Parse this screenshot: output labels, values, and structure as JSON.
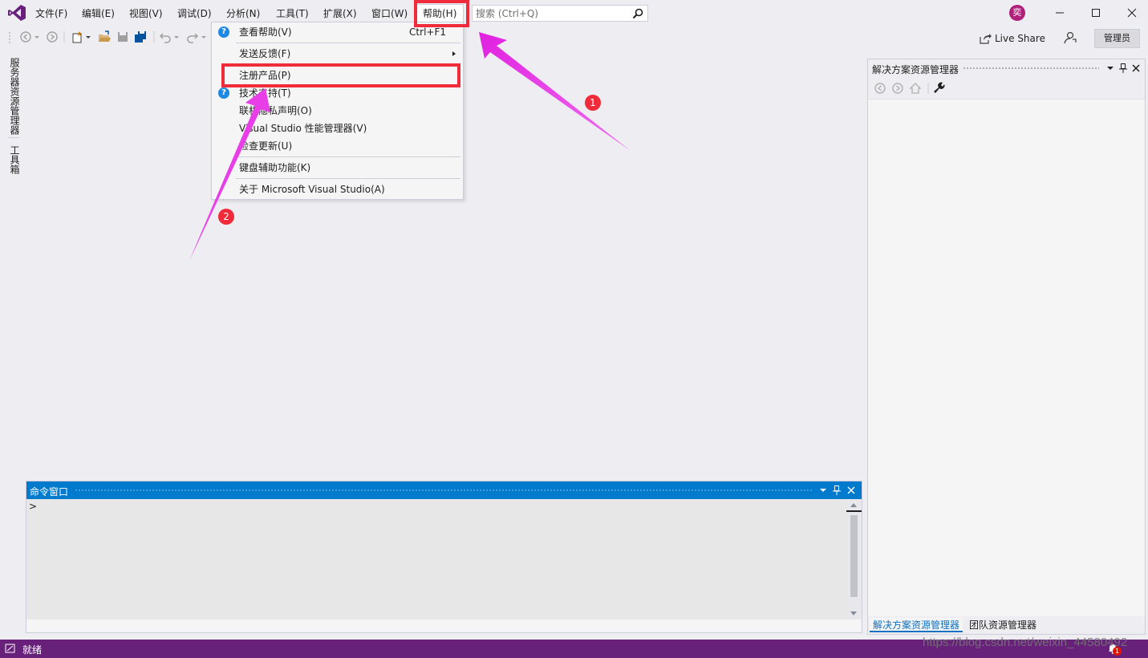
{
  "menubar": {
    "items": [
      {
        "label": "文件(F)"
      },
      {
        "label": "编辑(E)"
      },
      {
        "label": "视图(V)"
      },
      {
        "label": "调试(D)"
      },
      {
        "label": "分析(N)"
      },
      {
        "label": "工具(T)"
      },
      {
        "label": "扩展(X)"
      },
      {
        "label": "窗口(W)"
      },
      {
        "label": "帮助(H)"
      }
    ],
    "search_placeholder": "搜索 (Ctrl+Q)",
    "user_avatar": "奕"
  },
  "toolbar": {
    "live_share_label": "Live Share",
    "admin_label": "管理员"
  },
  "left_tabs": {
    "server_explorer": "服务器资源管理器",
    "toolbox": "工具箱"
  },
  "help_menu": {
    "items": [
      {
        "label": "查看帮助(V)",
        "shortcut": "Ctrl+F1"
      },
      {
        "label": "发送反馈(F)"
      },
      {
        "label": "注册产品(P)"
      },
      {
        "label": "技术支持(T)"
      },
      {
        "label": "联机隐私声明(O)"
      },
      {
        "label": "Visual Studio 性能管理器(V)"
      },
      {
        "label": "检查更新(U)"
      },
      {
        "label": "键盘辅助功能(K)"
      },
      {
        "label": "关于 Microsoft Visual Studio(A)"
      }
    ]
  },
  "solution_panel": {
    "title": "解决方案资源管理器",
    "tabs": [
      {
        "label": "解决方案资源管理器"
      },
      {
        "label": "团队资源管理器"
      }
    ]
  },
  "command_window": {
    "title": "命令窗口",
    "prompt": ">"
  },
  "statusbar": {
    "text": "就绪",
    "notification_count": "1"
  },
  "annotations": {
    "step_1": "1",
    "step_2": "2",
    "accent": "#f02b3a",
    "arrow_color": "#e83ee8"
  },
  "watermark": "https://blog.csdn.net/weixin_44580492"
}
